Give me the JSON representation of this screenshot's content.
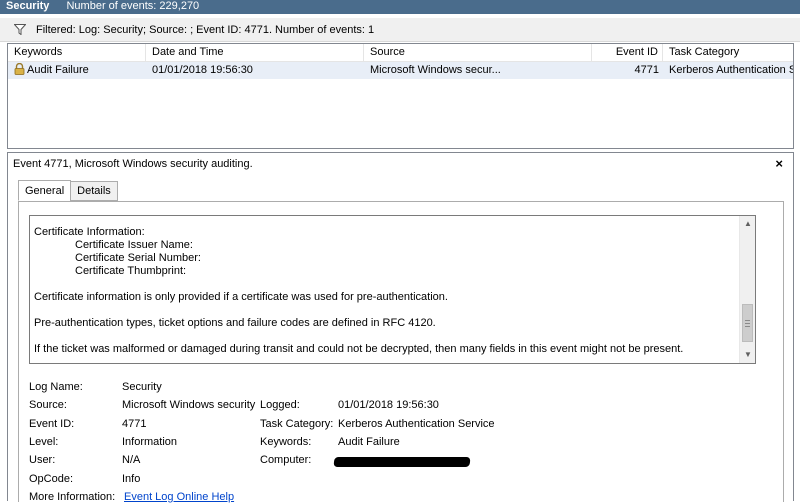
{
  "titlebar": {
    "title": "Security",
    "count": "Number of events: 229,270"
  },
  "filter": {
    "icon": "funnel-icon",
    "text": "Filtered: Log: Security; Source: ; Event ID: 4771. Number of events: 1"
  },
  "grid": {
    "columns": [
      "Keywords",
      "Date and Time",
      "Source",
      "Event ID",
      "Task Category"
    ],
    "rows": [
      {
        "icon": "lock-icon",
        "keywords": "Audit Failure",
        "datetime": "01/01/2018 19:56:30",
        "source": "Microsoft Windows secur...",
        "event_id": "4771",
        "task_category": "Kerberos Authentication S..."
      }
    ]
  },
  "detail": {
    "header": "Event 4771, Microsoft Windows security auditing.",
    "close_label": "×",
    "tabs": [
      "General",
      "Details"
    ],
    "active_tab": "General",
    "description": {
      "cert_heading": "Certificate Information:",
      "issuer": "Certificate Issuer Name:",
      "serial": "Certificate Serial Number:",
      "thumbprint": "Certificate Thumbprint:",
      "line_cert_info": "Certificate information is only provided if a certificate was used for pre-authentication.",
      "line_preauth": "Pre-authentication types, ticket options and failure codes are defined in RFC 4120.",
      "line_malformed": "If the ticket was malformed or damaged during transit and could not be decrypted, then many fields in this event might not be present."
    },
    "properties": {
      "log_name_label": "Log Name:",
      "log_name": "Security",
      "source_label": "Source:",
      "source": "Microsoft Windows security",
      "logged_label": "Logged:",
      "logged": "01/01/2018 19:56:30",
      "event_id_label": "Event ID:",
      "event_id": "4771",
      "task_category_label": "Task Category:",
      "task_category": "Kerberos Authentication Service",
      "level_label": "Level:",
      "level": "Information",
      "keywords_label": "Keywords:",
      "keywords": "Audit Failure",
      "user_label": "User:",
      "user": "N/A",
      "computer_label": "Computer:",
      "opcode_label": "OpCode:",
      "opcode": "Info",
      "more_info_label": "More Information:",
      "more_info_link": "Event Log Online Help"
    }
  }
}
